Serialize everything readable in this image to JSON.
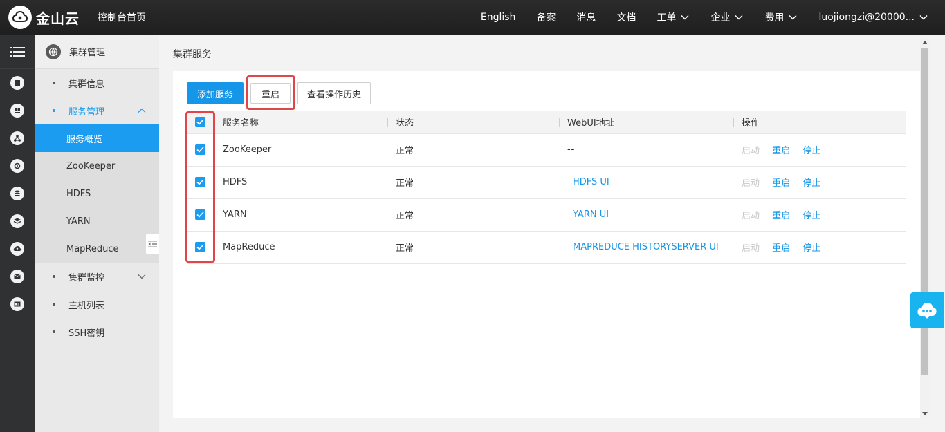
{
  "header": {
    "brand_name": "金山云",
    "console_home": "控制台首页",
    "nav": [
      {
        "label": "English"
      },
      {
        "label": "备案"
      },
      {
        "label": "消息"
      },
      {
        "label": "文档"
      },
      {
        "label": "工单"
      },
      {
        "label": "企业"
      },
      {
        "label": "费用"
      },
      {
        "label": "luojiongzi@20000..."
      }
    ]
  },
  "sidebar": {
    "section_title": "集群管理",
    "items": [
      {
        "label": "集群信息"
      },
      {
        "label": "服务管理"
      },
      {
        "label": "集群监控"
      },
      {
        "label": "主机列表"
      },
      {
        "label": "SSH密钥"
      }
    ],
    "service_sub_items": [
      {
        "label": "服务概览"
      },
      {
        "label": "ZooKeeper"
      },
      {
        "label": "HDFS"
      },
      {
        "label": "YARN"
      },
      {
        "label": "MapReduce"
      }
    ]
  },
  "main": {
    "title": "集群服务",
    "toolbar": {
      "add_label": "添加服务",
      "restart_label": "重启",
      "history_label": "查看操作历史"
    },
    "table": {
      "columns": [
        "服务名称",
        "状态",
        "WebUI地址",
        "操作"
      ],
      "rows": [
        {
          "name": "ZooKeeper",
          "status": "正常",
          "webui": "--",
          "op_start": "启动",
          "op_restart": "重启",
          "op_stop": "停止"
        },
        {
          "name": "HDFS",
          "status": "正常",
          "webui": "HDFS UI",
          "op_start": "启动",
          "op_restart": "重启",
          "op_stop": "停止"
        },
        {
          "name": "YARN",
          "status": "正常",
          "webui": "YARN UI",
          "op_start": "启动",
          "op_restart": "重启",
          "op_stop": "停止"
        },
        {
          "name": "MapReduce",
          "status": "正常",
          "webui": "MAPREDUCE HISTORYSERVER UI",
          "op_start": "启动",
          "op_restart": "重启",
          "op_stop": "停止"
        }
      ]
    }
  },
  "colors": {
    "accent": "#1596e8",
    "highlight": "#e0454a",
    "topbar": "#222222",
    "rail": "#2f3133"
  }
}
